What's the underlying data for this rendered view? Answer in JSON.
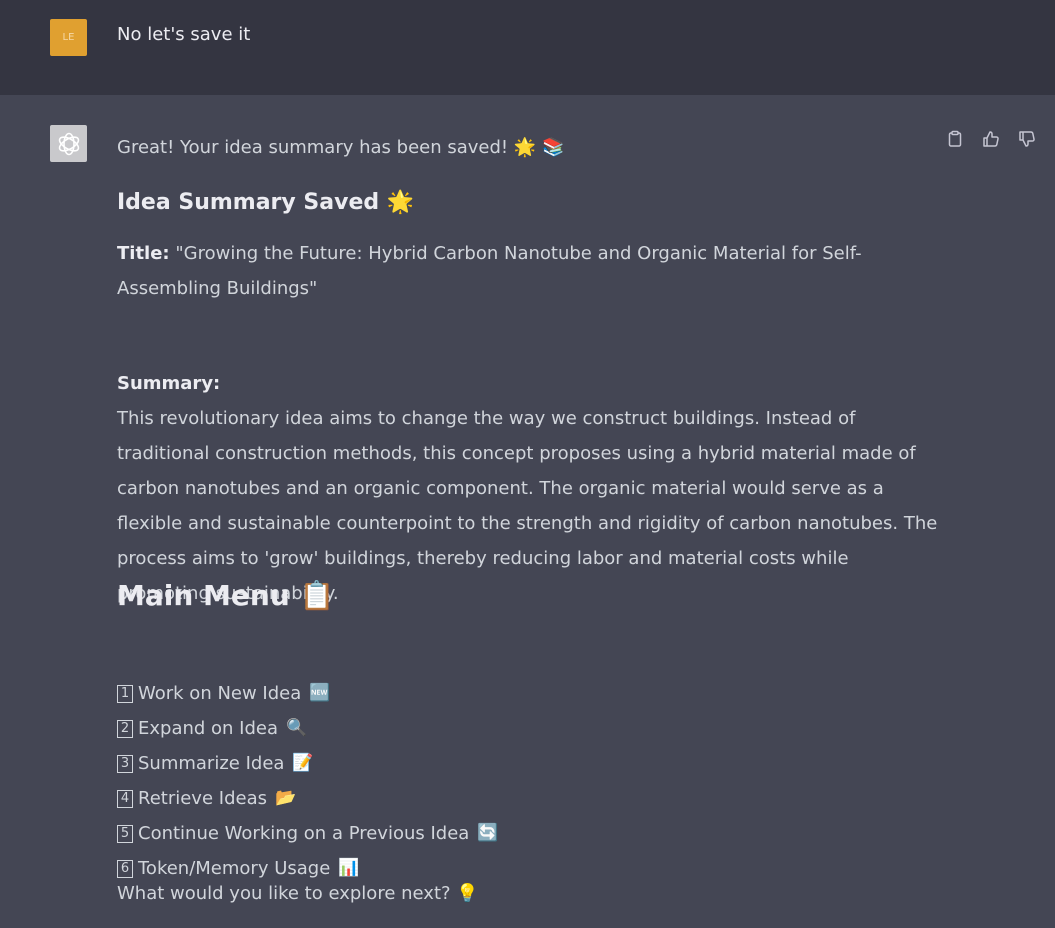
{
  "user_message": {
    "avatar_text": "LE",
    "text": "No let's save it"
  },
  "assistant_message": {
    "intro": "Great! Your idea summary has been saved! 🌟 📚",
    "saved_heading": "Idea Summary Saved 🌟",
    "title_label": "Title:",
    "title_text": " \"Growing the Future: Hybrid Carbon Nanotube and Organic Material for Self-Assembling Buildings\"",
    "summary_label": "Summary:",
    "summary_text": "This revolutionary idea aims to change the way we construct buildings. Instead of traditional construction methods, this concept proposes using a hybrid material made of carbon nanotubes and an organic component. The organic material would serve as a flexible and sustainable counterpoint to the strength and rigidity of carbon nanotubes. The process aims to 'grow' buildings, thereby reducing labor and material costs while promoting sustainability.",
    "menu_heading": "Main Menu 📋",
    "menu_items": [
      {
        "num": "1",
        "label": "Work on New Idea",
        "emoji": "🆕"
      },
      {
        "num": "2",
        "label": "Expand on Idea",
        "emoji": "🔍"
      },
      {
        "num": "3",
        "label": "Summarize Idea",
        "emoji": "📝"
      },
      {
        "num": "4",
        "label": "Retrieve Ideas",
        "emoji": "📂"
      },
      {
        "num": "5",
        "label": "Continue Working on a Previous Idea",
        "emoji": "🔄"
      },
      {
        "num": "6",
        "label": "Token/Memory Usage",
        "emoji": "📊"
      }
    ],
    "closing": "What would you like to explore next? 💡"
  },
  "actions": {
    "copy": "copy-icon",
    "thumbs_up": "thumbs-up-icon",
    "thumbs_down": "thumbs-down-icon"
  },
  "colors": {
    "user_bg": "#343541",
    "assistant_bg": "#444654",
    "user_avatar": "#e0a030",
    "text": "#d1d5db"
  }
}
